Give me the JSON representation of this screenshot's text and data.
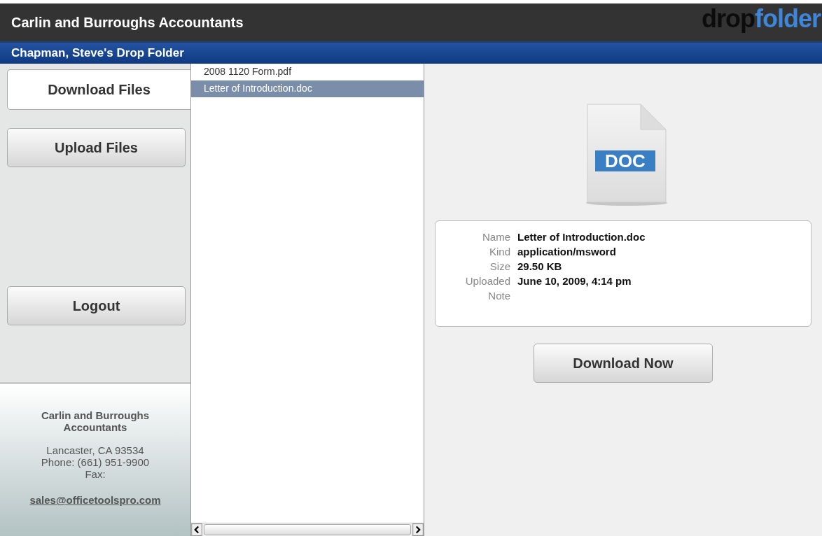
{
  "header": {
    "title": "Carlin and Burroughs Accountants",
    "logo": {
      "first": "drop",
      "second": "folder"
    }
  },
  "subheader": {
    "title": "Chapman, Steve's Drop Folder"
  },
  "nav": [
    {
      "label": "Download Files",
      "selected": true
    },
    {
      "label": "Upload Files",
      "selected": false
    },
    {
      "label": "Logout",
      "selected": false,
      "kind": "spaced"
    }
  ],
  "footer": {
    "company": "Carlin and Burroughs Accountants",
    "lines": [
      "Lancaster, CA 93534",
      "Phone: (661) 951-9900",
      "Fax:"
    ],
    "email": "sales@officetoolspro.com"
  },
  "files": [
    {
      "name": "2008 1120 Form.pdf",
      "selected": false
    },
    {
      "name": "Letter of Introduction.doc",
      "selected": true
    }
  ],
  "preview": {
    "badge": "DOC"
  },
  "details": [
    {
      "label": "Name",
      "value": "Letter of Introduction.doc"
    },
    {
      "label": "Kind",
      "value": "application/msword"
    },
    {
      "label": "Size",
      "value": "29.50 KB"
    },
    {
      "label": "Uploaded",
      "value": "June 10, 2009, 4:14 pm"
    },
    {
      "label": "Note"
    }
  ],
  "download_button": "Download Now"
}
